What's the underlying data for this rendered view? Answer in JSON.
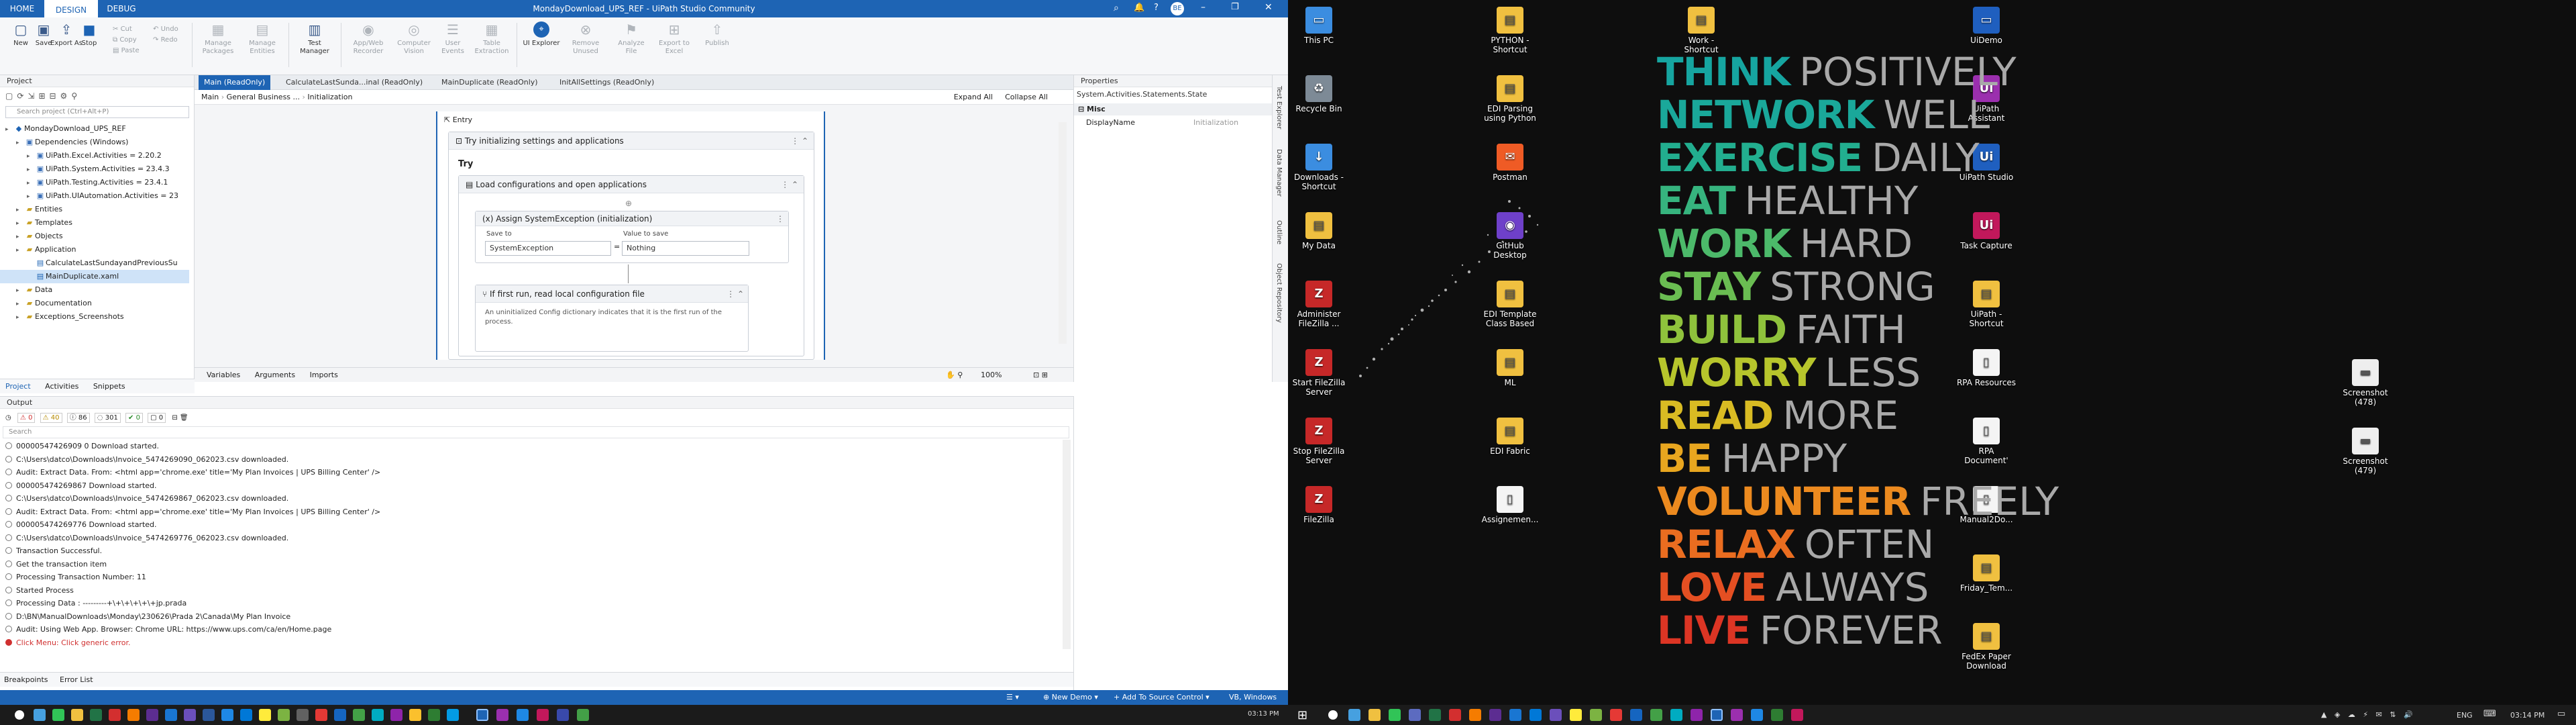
{
  "studio": {
    "window_title": "MondayDownload_UPS_REF - UiPath Studio Community",
    "tabs": [
      "HOME",
      "DESIGN",
      "DEBUG"
    ],
    "user_initials": "BE",
    "ribbon": {
      "new": "New",
      "save": "Save",
      "export": "Export As",
      "stop": "Stop",
      "cut": "Cut",
      "copy": "Copy",
      "paste": "Paste",
      "undo": "Undo",
      "redo": "Redo",
      "manage_packages": "Manage Packages",
      "manage_entities": "Manage Entities",
      "test_manager": "Test Manager",
      "app_web_recorder": "App/Web Recorder",
      "computer_vision": "Computer Vision",
      "user_events": "User Events",
      "table_extraction": "Table Extraction",
      "ui_explorer": "UI Explorer",
      "remove_unused": "Remove Unused",
      "analyze_file": "Analyze File",
      "export_excel": "Export to Excel",
      "publish": "Publish"
    },
    "project": {
      "header": "Project",
      "search_placeholder": "Search project (Ctrl+Alt+P)",
      "tree": [
        {
          "label": "MondayDownload_UPS_REF",
          "depth": 0,
          "icon": "project-icon"
        },
        {
          "label": "Dependencies (Windows)",
          "depth": 1,
          "icon": "package-icon"
        },
        {
          "label": "UiPath.Excel.Activities = 2.20.2",
          "depth": 2,
          "icon": "package-icon"
        },
        {
          "label": "UiPath.System.Activities = 23.4.3",
          "depth": 2,
          "icon": "package-icon"
        },
        {
          "label": "UiPath.Testing.Activities = 23.4.1",
          "depth": 2,
          "icon": "package-icon"
        },
        {
          "label": "UiPath.UIAutomation.Activities = 23",
          "depth": 2,
          "icon": "package-icon"
        },
        {
          "label": "Entities",
          "depth": 1,
          "icon": "folder-icon"
        },
        {
          "label": "Templates",
          "depth": 1,
          "icon": "folder-icon"
        },
        {
          "label": "Objects",
          "depth": 1,
          "icon": "folder-icon"
        },
        {
          "label": "Application",
          "depth": 1,
          "icon": "folder-icon"
        },
        {
          "label": "CalculateLastSundayandPreviousSu",
          "depth": 2,
          "icon": "xaml-icon"
        },
        {
          "label": "MainDuplicate.xaml",
          "depth": 2,
          "icon": "xaml-icon"
        },
        {
          "label": "Data",
          "depth": 1,
          "icon": "folder-icon"
        },
        {
          "label": "Documentation",
          "depth": 1,
          "icon": "folder-icon"
        },
        {
          "label": "Exceptions_Screenshots",
          "depth": 1,
          "icon": "folder-icon"
        }
      ],
      "bottom_tabs": [
        "Project",
        "Activities",
        "Snippets"
      ]
    },
    "designer": {
      "tabs": [
        "Main (ReadOnly)",
        "CalculateLastSunda...inal (ReadOnly)",
        "MainDuplicate (ReadOnly)",
        "InitAllSettings (ReadOnly)"
      ],
      "breadcrumb": [
        "Main",
        "General Business ...",
        "Initialization"
      ],
      "expand_all": "Expand All",
      "collapse_all": "Collapse All",
      "entry": "Entry",
      "try_catch": "Try initializing settings and applications",
      "try_label": "Try",
      "sequence": "Load configurations and open applications",
      "assign": "Assign SystemException (initialization)",
      "save_to_label": "Save to",
      "value_label": "Value to save",
      "save_to": "SystemException",
      "value": "Nothing",
      "if_title": "If first run, read local configuration file",
      "if_desc": "An uninitialized Config dictionary indicates that it is the first run of the process.",
      "bottom_tabs": [
        "Variables",
        "Arguments",
        "Imports"
      ],
      "zoom": "100%"
    },
    "properties": {
      "header": "Properties",
      "type": "System.Activities.Statements.State",
      "category": "Misc",
      "prop_name": "DisplayName",
      "prop_value": "Initialization",
      "side_tabs": [
        "Test Explorer",
        "Data Manager",
        "Outline",
        "Object Repository"
      ]
    },
    "output": {
      "header": "Output",
      "counts": [
        "0",
        "40",
        "86",
        "301",
        "0",
        "0"
      ],
      "search_placeholder": "Search",
      "lines": [
        {
          "text": "00000547426909 0 Download started.",
          "type": "info"
        },
        {
          "text": "C:\\Users\\datco\\Downloads\\Invoice_5474269090_062023.csv downloaded.",
          "type": "info"
        },
        {
          "text": "Audit: Extract Data. From: <html app='chrome.exe' title='My Plan Invoices | UPS Billing Center' />",
          "type": "info"
        },
        {
          "text": "000005474269867 Download started.",
          "type": "info"
        },
        {
          "text": "C:\\Users\\datco\\Downloads\\Invoice_5474269867_062023.csv downloaded.",
          "type": "info"
        },
        {
          "text": "Audit: Extract Data. From: <html app='chrome.exe' title='My Plan Invoices | UPS Billing Center' />",
          "type": "info"
        },
        {
          "text": "000005474269776 Download started.",
          "type": "info"
        },
        {
          "text": "C:\\Users\\datco\\Downloads\\Invoice_5474269776_062023.csv downloaded.",
          "type": "info"
        },
        {
          "text": "Transaction Successful.",
          "type": "info"
        },
        {
          "text": "Get the transaction item",
          "type": "info"
        },
        {
          "text": "Processing Transaction Number: 11",
          "type": "info"
        },
        {
          "text": "Started Process",
          "type": "info"
        },
        {
          "text": "Processing Data : ---------+\\+\\+\\+\\+\\+jp.prada",
          "type": "info"
        },
        {
          "text": "D:\\BN\\ManualDownloads\\Monday\\230626\\Prada 2\\Canada\\My Plan Invoice",
          "type": "info"
        },
        {
          "text": "Audit: Using Web App. Browser: Chrome URL: https://www.ups.com/ca/en/Home.page",
          "type": "info"
        },
        {
          "text": "Click Menu: Click generic error.",
          "type": "err"
        }
      ],
      "bottom_tabs": [
        "Breakpoints",
        "Error List"
      ]
    },
    "statusbar": {
      "demo": "New Demo",
      "source_control": "Add To Source Control",
      "target": "VB, Windows"
    },
    "clock_left": "03:13 PM"
  },
  "desktop": {
    "icons": [
      {
        "label": "This PC",
        "color": "#3b8de0",
        "glyph": "▭"
      },
      {
        "label": "Recycle Bin",
        "color": "#7d8a96",
        "glyph": "♻"
      },
      {
        "label": "Downloads - Shortcut",
        "color": "#3b8de0",
        "glyph": "↓"
      },
      {
        "label": "My Data",
        "color": "#f0c040",
        "glyph": "▤"
      },
      {
        "label": "Administer FileZilla ...",
        "color": "#c62828",
        "glyph": "Z"
      },
      {
        "label": "Start FileZilla Server",
        "color": "#c62828",
        "glyph": "Z"
      },
      {
        "label": "Stop FileZilla Server",
        "color": "#c62828",
        "glyph": "Z"
      },
      {
        "label": "FileZilla",
        "color": "#c62828",
        "glyph": "Z"
      },
      {
        "label": "PYTHON - Shortcut",
        "color": "#f0c040",
        "glyph": "▤"
      },
      {
        "label": "EDI Parsing using Python",
        "color": "#f0c040",
        "glyph": "▤"
      },
      {
        "label": "Postman",
        "color": "#ef5b25",
        "glyph": "✉"
      },
      {
        "label": "GitHub Desktop",
        "color": "#6e40c9",
        "glyph": "◉"
      },
      {
        "label": "EDI Template Class Based",
        "color": "#f0c040",
        "glyph": "▤"
      },
      {
        "label": "ML",
        "color": "#f0c040",
        "glyph": "▤"
      },
      {
        "label": "EDI Fabric",
        "color": "#f0c040",
        "glyph": "▤"
      },
      {
        "label": "Assignemen...",
        "color": "#f4f4f4",
        "glyph": "▯"
      },
      {
        "label": "Work - Shortcut",
        "color": "#f0c040",
        "glyph": "▤"
      },
      {
        "label": "UiDemo",
        "color": "#1f5fbf",
        "glyph": "▭"
      },
      {
        "label": "UiPath Assistant",
        "color": "#9b2fae",
        "glyph": "Ui"
      },
      {
        "label": "UiPath Studio",
        "color": "#1f5fbf",
        "glyph": "Ui"
      },
      {
        "label": "Task Capture",
        "color": "#c2185b",
        "glyph": "Ui"
      },
      {
        "label": "UiPath - Shortcut",
        "color": "#f0c040",
        "glyph": "▤"
      },
      {
        "label": "RPA Resources",
        "color": "#f4f4f4",
        "glyph": "▯"
      },
      {
        "label": "RPA Document'",
        "color": "#f4f4f4",
        "glyph": "▯"
      },
      {
        "label": "Manual2Do...",
        "color": "#f4f4f4",
        "glyph": "▯"
      },
      {
        "label": "Friday_Tem...",
        "color": "#f0c040",
        "glyph": "▤"
      },
      {
        "label": "FedEx Paper Download",
        "color": "#f0c040",
        "glyph": "▤"
      },
      {
        "label": "Screenshot (478)",
        "color": "#eeeeee",
        "glyph": "▬"
      },
      {
        "label": "Screenshot (479)",
        "color": "#eeeeee",
        "glyph": "▬"
      }
    ],
    "wallpaper": [
      {
        "bold": "THINK",
        "thin": "POSITIVELY",
        "color": "#16a5a0"
      },
      {
        "bold": "NETWORK",
        "thin": "WELL",
        "color": "#1aa89a"
      },
      {
        "bold": "EXERCISE",
        "thin": "DAILY",
        "color": "#22ae8f"
      },
      {
        "bold": "EAT",
        "thin": "HEALTHY",
        "color": "#36b47e"
      },
      {
        "bold": "WORK",
        "thin": "HARD",
        "color": "#4cb96a"
      },
      {
        "bold": "STAY",
        "thin": "STRONG",
        "color": "#6abd52"
      },
      {
        "bold": "BUILD",
        "thin": "FAITH",
        "color": "#8fc23c"
      },
      {
        "bold": "WORRY",
        "thin": "LESS",
        "color": "#b7c52c"
      },
      {
        "bold": "READ",
        "thin": "MORE",
        "color": "#d9bb23"
      },
      {
        "bold": "BE",
        "thin": "HAPPY",
        "color": "#e8a61f"
      },
      {
        "bold": "VOLUNTEER",
        "thin": "FREELY",
        "color": "#ec8a1f"
      },
      {
        "bold": "RELAX",
        "thin": "OFTEN",
        "color": "#ea6d20"
      },
      {
        "bold": "LOVE",
        "thin": "ALWAYS",
        "color": "#e44f22"
      },
      {
        "bold": "LIVE",
        "thin": "FOREVER",
        "color": "#dc3524"
      }
    ],
    "tray": {
      "lang": "ENG",
      "time": "03:14 PM"
    }
  }
}
